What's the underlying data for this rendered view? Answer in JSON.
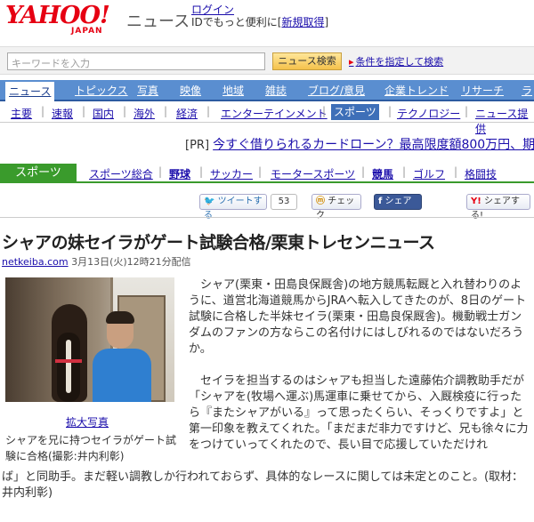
{
  "header": {
    "logo_text": "YAHOO!",
    "logo_sub": "JAPAN",
    "section": "ニュース",
    "login": "ログイン",
    "login_sub_prefix": "IDでもっと便利に[",
    "signup": "新規取得",
    "login_sub_suffix": "]"
  },
  "search": {
    "placeholder": "キーワードを入力",
    "button": "ニュース検索",
    "advanced": "条件を指定して検索"
  },
  "nav": [
    "ニュース",
    "トピックス",
    "写真",
    "映像",
    "地域",
    "雑誌",
    "ブログ/意見",
    "企業トレンド",
    "リサーチ",
    "ラ"
  ],
  "subnav": [
    "主要",
    "速報",
    "国内",
    "海外",
    "経済",
    "エンターテインメント",
    "スポーツ",
    "テクノロジー",
    "ニュース提供"
  ],
  "pr": {
    "label": "[PR]",
    "text": "今すぐ借りられるカードローン？最高限度額800万円、期"
  },
  "sports": {
    "tab": "スポーツ",
    "items": [
      "スポーツ総合",
      "野球",
      "サッカー",
      "モータースポーツ",
      "競馬",
      "ゴルフ",
      "格闘技"
    ]
  },
  "social": {
    "tweet": "ツイートする",
    "tweet_count": "53",
    "check": "チェック",
    "facebook": "シェア",
    "yahoo_share": "シェアする!"
  },
  "article": {
    "title": "シャアの妹セイラがゲート試験合格/栗東トレセンニュース",
    "source": "netkeiba.com",
    "date": "3月13日(火)12時21分配信",
    "zoom": "拡大写真",
    "caption": "シャアを兄に持つセイラがゲート試験に合格(撮影:井内利彰)",
    "para1": "シャア(栗東・田島良保厩舎)の地方競馬転厩と入れ替わりのように、道営北海道競馬からJRAへ転入してきたのが、8日のゲート試験に合格した半妹セイラ(栗東・田島良保厩舎)。機動戦士ガンダムのファンの方ならこの名付けにはしびれるのではないだろうか。",
    "para2a": "セイラを担当するのはシャアも担当した遠藤佑介調教助手だが「シャアを(牧場へ運ぶ)馬運車に乗せてから、入厩検疫に行ったら『またシャアがいる』って思ったくらい、そっくりですよ」と第一印象を教えてくれた。「まだまだ非力ですけど、兄も徐々に力をつけていってくれたので、長い目で応援していただけれ",
    "para2b": "ば」と同助手。まだ軽い調教しか行われておらず、具体的なレースに関しては未定とのこと。(取材：井内利彰)"
  }
}
